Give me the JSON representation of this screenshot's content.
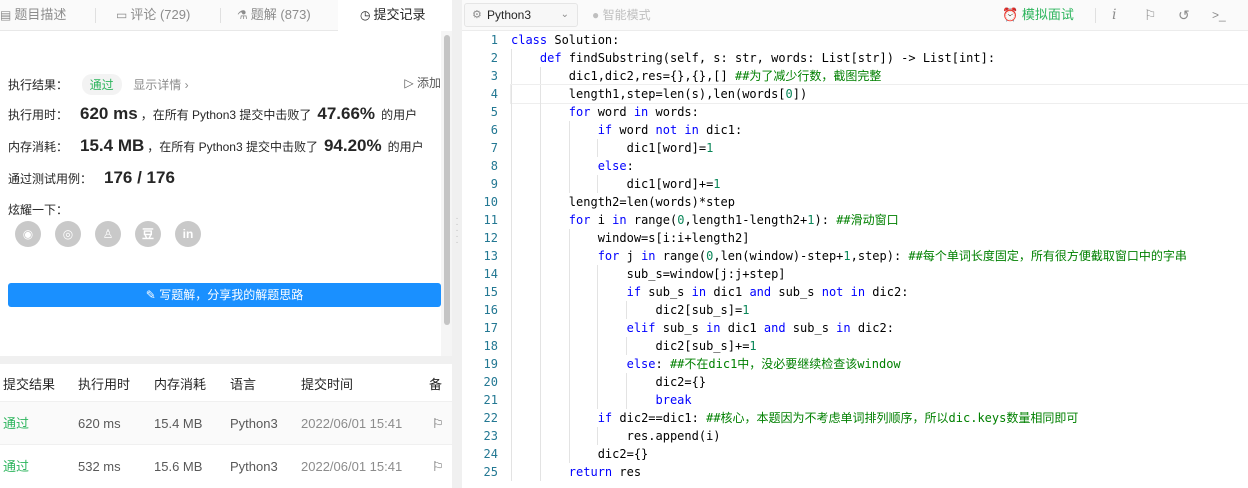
{
  "tabs": [
    {
      "icon": "description-icon",
      "label": "题目描述"
    },
    {
      "icon": "comment-icon",
      "label": "评论 (729)"
    },
    {
      "icon": "flask-icon",
      "label": "题解 (873)"
    },
    {
      "icon": "history-icon",
      "label": "提交记录"
    }
  ],
  "result": {
    "exec_label": "执行结果：",
    "status": "通过",
    "details_link": "显示详情 ›",
    "add_note": "添加",
    "time_label": "执行用时：",
    "time_value": "620 ms",
    "time_beat_pre": "，在所有 Python3 提交中击败了",
    "time_pct": "47.66%",
    "users_suffix": "的用户",
    "mem_label": "内存消耗：",
    "mem_value": "15.4 MB",
    "mem_beat_pre": "，在所有 Python3 提交中击败了",
    "mem_pct": "94.20%",
    "cases_label": "通过测试用例：",
    "cases_value": "176 / 176",
    "share_label": "炫耀一下：",
    "share_icons": [
      "wechat-icon",
      "weibo-icon",
      "qq-icon",
      "douban-icon",
      "linkedin-icon"
    ],
    "write_button": "写题解，分享我的解题思路"
  },
  "table": {
    "headers": [
      "提交结果",
      "执行用时",
      "内存消耗",
      "语言",
      "提交时间",
      "备"
    ],
    "rows": [
      {
        "status": "通过",
        "time": "620 ms",
        "mem": "15.4 MB",
        "lang": "Python3",
        "date": "2022/06/01 15:41"
      },
      {
        "status": "通过",
        "time": "532 ms",
        "mem": "15.6 MB",
        "lang": "Python3",
        "date": "2022/06/01 15:41"
      }
    ]
  },
  "toolbar": {
    "language": "Python3",
    "smart_mode": "智能模式",
    "interview": "模拟面试"
  },
  "colors": {
    "accent_green": "#2db55d",
    "button_blue": "#1a90ff"
  },
  "code": {
    "lines": [
      [
        {
          "t": "class ",
          "c": "kw"
        },
        {
          "t": "Solution:",
          "c": ""
        }
      ],
      [
        {
          "t": "    ",
          "c": ""
        },
        {
          "t": "def ",
          "c": "kw"
        },
        {
          "t": "findSubstring(self, s: str, words: List[str]) -> List[int]:",
          "c": ""
        }
      ],
      [
        {
          "t": "        dic1,dic2,res={},{},[] ",
          "c": ""
        },
        {
          "t": "##为了减少行数，截图完整",
          "c": "cm"
        }
      ],
      [
        {
          "t": "        length1,step=len(s),len(words[",
          "c": ""
        },
        {
          "t": "0",
          "c": "nm"
        },
        {
          "t": "])",
          "c": ""
        }
      ],
      [
        {
          "t": "        ",
          "c": ""
        },
        {
          "t": "for ",
          "c": "kw"
        },
        {
          "t": "word ",
          "c": ""
        },
        {
          "t": "in ",
          "c": "kw"
        },
        {
          "t": "words:",
          "c": ""
        }
      ],
      [
        {
          "t": "            ",
          "c": ""
        },
        {
          "t": "if ",
          "c": "kw"
        },
        {
          "t": "word ",
          "c": ""
        },
        {
          "t": "not in ",
          "c": "kw"
        },
        {
          "t": "dic1:",
          "c": ""
        }
      ],
      [
        {
          "t": "                dic1[word]=",
          "c": ""
        },
        {
          "t": "1",
          "c": "nm"
        }
      ],
      [
        {
          "t": "            ",
          "c": ""
        },
        {
          "t": "else",
          "c": "kw"
        },
        {
          "t": ":",
          "c": ""
        }
      ],
      [
        {
          "t": "                dic1[word]+=",
          "c": ""
        },
        {
          "t": "1",
          "c": "nm"
        }
      ],
      [
        {
          "t": "        length2=len(words)*step",
          "c": ""
        }
      ],
      [
        {
          "t": "        ",
          "c": ""
        },
        {
          "t": "for ",
          "c": "kw"
        },
        {
          "t": "i ",
          "c": ""
        },
        {
          "t": "in ",
          "c": "kw"
        },
        {
          "t": "range(",
          "c": ""
        },
        {
          "t": "0",
          "c": "nm"
        },
        {
          "t": ",length1-length2+",
          "c": ""
        },
        {
          "t": "1",
          "c": "nm"
        },
        {
          "t": "): ",
          "c": ""
        },
        {
          "t": "##滑动窗口",
          "c": "cm"
        }
      ],
      [
        {
          "t": "            window=s[i:i+length2]",
          "c": ""
        }
      ],
      [
        {
          "t": "            ",
          "c": ""
        },
        {
          "t": "for ",
          "c": "kw"
        },
        {
          "t": "j ",
          "c": ""
        },
        {
          "t": "in ",
          "c": "kw"
        },
        {
          "t": "range(",
          "c": ""
        },
        {
          "t": "0",
          "c": "nm"
        },
        {
          "t": ",len(window)-step+",
          "c": ""
        },
        {
          "t": "1",
          "c": "nm"
        },
        {
          "t": ",step): ",
          "c": ""
        },
        {
          "t": "##每个单词长度固定，所有很方便截取窗口中的字串",
          "c": "cm"
        }
      ],
      [
        {
          "t": "                sub_s=window[j:j+step]",
          "c": ""
        }
      ],
      [
        {
          "t": "                ",
          "c": ""
        },
        {
          "t": "if ",
          "c": "kw"
        },
        {
          "t": "sub_s ",
          "c": ""
        },
        {
          "t": "in ",
          "c": "kw"
        },
        {
          "t": "dic1 ",
          "c": ""
        },
        {
          "t": "and ",
          "c": "kw"
        },
        {
          "t": "sub_s ",
          "c": ""
        },
        {
          "t": "not in ",
          "c": "kw"
        },
        {
          "t": "dic2:",
          "c": ""
        }
      ],
      [
        {
          "t": "                    dic2[sub_s]=",
          "c": ""
        },
        {
          "t": "1",
          "c": "nm"
        }
      ],
      [
        {
          "t": "                ",
          "c": ""
        },
        {
          "t": "elif ",
          "c": "kw"
        },
        {
          "t": "sub_s ",
          "c": ""
        },
        {
          "t": "in ",
          "c": "kw"
        },
        {
          "t": "dic1 ",
          "c": ""
        },
        {
          "t": "and ",
          "c": "kw"
        },
        {
          "t": "sub_s ",
          "c": ""
        },
        {
          "t": "in ",
          "c": "kw"
        },
        {
          "t": "dic2:",
          "c": ""
        }
      ],
      [
        {
          "t": "                    dic2[sub_s]+=",
          "c": ""
        },
        {
          "t": "1",
          "c": "nm"
        }
      ],
      [
        {
          "t": "                ",
          "c": ""
        },
        {
          "t": "else",
          "c": "kw"
        },
        {
          "t": ": ",
          "c": ""
        },
        {
          "t": "##不在dic1中，没必要继续检查该window",
          "c": "cm"
        }
      ],
      [
        {
          "t": "                    dic2={}",
          "c": ""
        }
      ],
      [
        {
          "t": "                    ",
          "c": ""
        },
        {
          "t": "break",
          "c": "kw"
        }
      ],
      [
        {
          "t": "            ",
          "c": ""
        },
        {
          "t": "if ",
          "c": "kw"
        },
        {
          "t": "dic2==dic1: ",
          "c": ""
        },
        {
          "t": "##核心，本题因为不考虑单词排列顺序，所以dic.keys数量相同即可",
          "c": "cm"
        }
      ],
      [
        {
          "t": "                res.append(i)",
          "c": ""
        }
      ],
      [
        {
          "t": "            dic2={}",
          "c": ""
        }
      ],
      [
        {
          "t": "        ",
          "c": ""
        },
        {
          "t": "return ",
          "c": "kw"
        },
        {
          "t": "res",
          "c": ""
        }
      ]
    ]
  }
}
